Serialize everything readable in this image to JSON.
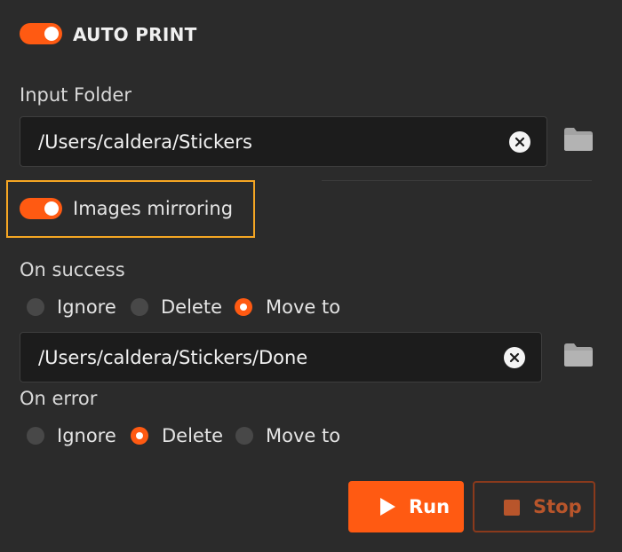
{
  "auto_print": {
    "label": "AUTO PRINT",
    "enabled": true
  },
  "input_folder": {
    "label": "Input Folder",
    "value": "/Users/caldera/Stickers",
    "clear_icon": "clear-icon",
    "browse_icon": "folder-icon"
  },
  "images_mirroring": {
    "label": "Images mirroring",
    "enabled": true
  },
  "on_success": {
    "label": "On success",
    "options": [
      "Ignore",
      "Delete",
      "Move to"
    ],
    "selected": "Move to",
    "move_to_path": "/Users/caldera/Stickers/Done"
  },
  "on_error": {
    "label": "On error",
    "options": [
      "Ignore",
      "Delete",
      "Move to"
    ],
    "selected": "Delete"
  },
  "actions": {
    "run_label": "Run",
    "stop_label": "Stop"
  },
  "colors": {
    "accent": "#ff5a12",
    "background": "#2b2b2b",
    "highlight": "#f5a623"
  }
}
